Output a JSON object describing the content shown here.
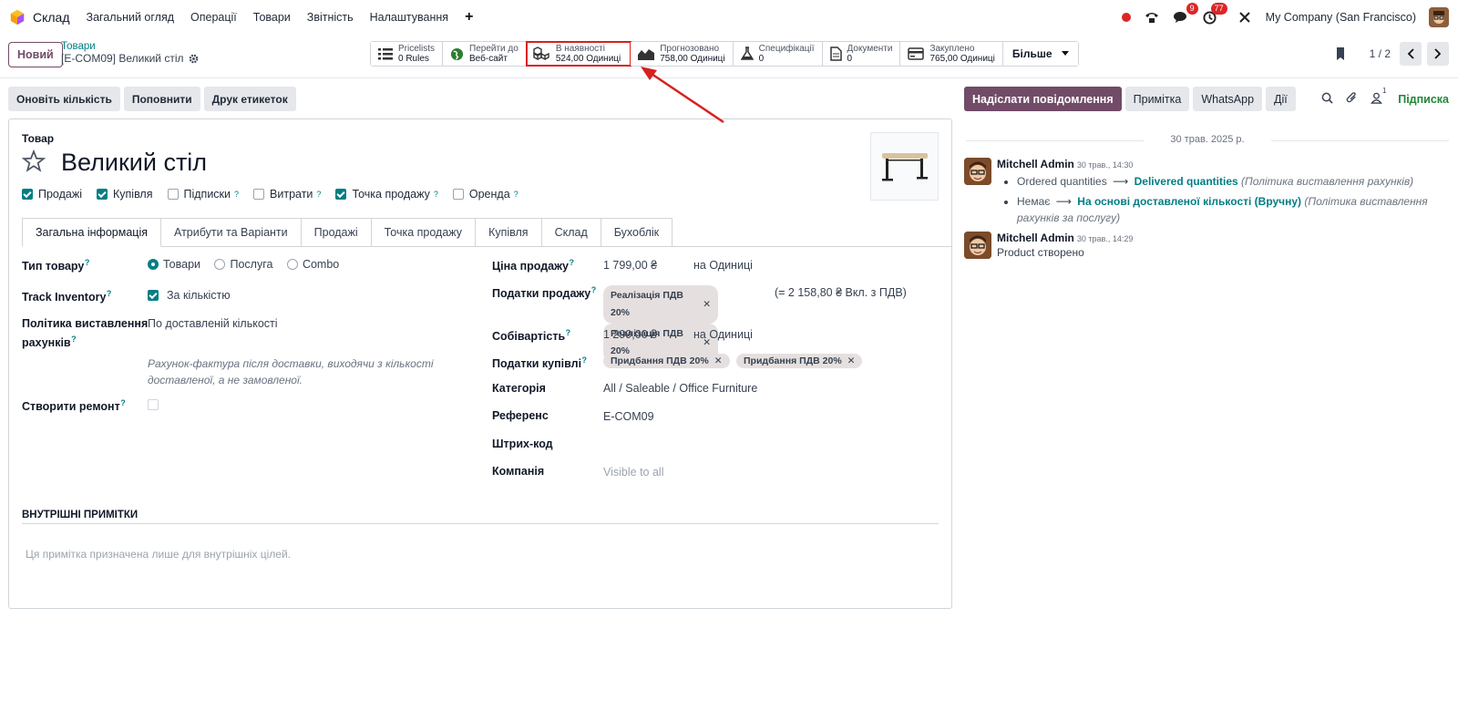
{
  "nav": {
    "app_name": "Склад",
    "menu": [
      "Загальний огляд",
      "Операції",
      "Товари",
      "Звітність",
      "Налаштування"
    ],
    "plus": "+",
    "messages_badge": "9",
    "activities_badge": "77",
    "company": "My Company (San Francisco)"
  },
  "control": {
    "new_button": "Новий",
    "breadcrumb_parent": "Товари",
    "breadcrumb_current": "[E-COM09] Великий стіл",
    "pager": "1 / 2",
    "more": "Більше"
  },
  "smart_buttons": [
    {
      "l1": "Pricelists",
      "l2": "0 Rules",
      "icon": "list-icon"
    },
    {
      "l1": "Перейти до",
      "l2": "Веб-сайт",
      "icon": "globe-icon"
    },
    {
      "l1": "В наявності",
      "l2": "524,00 Одиниці",
      "icon": "cubes-icon"
    },
    {
      "l1": "Прогнозовано",
      "l2": "758,00 Одиниці",
      "icon": "area-chart-icon"
    },
    {
      "l1": "Специфікації",
      "l2": "0",
      "icon": "flask-icon"
    },
    {
      "l1": "Документи",
      "l2": "0",
      "icon": "document-icon"
    },
    {
      "l1": "Закуплено",
      "l2": "765,00 Одиниці",
      "icon": "credit-card-icon"
    }
  ],
  "actions": [
    "Оновіть кількість",
    "Поповнити",
    "Друк етикеток"
  ],
  "product": {
    "type_label": "Товар",
    "name": "Великий стіл",
    "checkboxes": [
      {
        "label": "Продажі",
        "checked": true,
        "help": false
      },
      {
        "label": "Купівля",
        "checked": true,
        "help": false
      },
      {
        "label": "Підписки",
        "checked": false,
        "help": true
      },
      {
        "label": "Витрати",
        "checked": false,
        "help": true
      },
      {
        "label": "Точка продажу",
        "checked": true,
        "help": true
      },
      {
        "label": "Оренда",
        "checked": false,
        "help": true
      }
    ],
    "tabs": [
      "Загальна інформація",
      "Атрибути та Варіанти",
      "Продажі",
      "Точка продажу",
      "Купівля",
      "Склад",
      "Бухоблік"
    ]
  },
  "left_fields": {
    "product_type_label": "Тип товару",
    "product_type_options": [
      "Товари",
      "Послуга",
      "Combo"
    ],
    "track_label": "Track Inventory",
    "track_value": "За кількістю",
    "invoice_policy_label_1": "Політика виставлення",
    "invoice_policy_label_2": "рахунків",
    "invoice_policy_value": "По доставленій кількості",
    "invoice_hint_1": "Рахунок-фактура після доставки, виходячи з кількості",
    "invoice_hint_2": "доставленої, а не замовленої.",
    "repair_label": "Створити ремонт"
  },
  "right_fields": {
    "sale_price_label": "Ціна продажу",
    "sale_price": "1 799,00 ₴",
    "sale_uom": "на Одиниці",
    "sale_taxes_label": "Податки продажу",
    "sale_tax_tags": [
      "Реалізація ПДВ 20%",
      "Реалізація ПДВ 20%"
    ],
    "sale_taxes_incl": "(= 2 158,80 ₴ Вкл. з ПДВ)",
    "cost_label": "Собівартість",
    "cost": "1 299,00 ₴",
    "cost_uom": "на Одиниці",
    "purchase_taxes_label": "Податки купівлі",
    "purchase_tax_tags": [
      "Придбання ПДВ 20%",
      "Придбання ПДВ 20%"
    ],
    "category_label": "Категорія",
    "category": "All / Saleable / Office Furniture",
    "ref_label": "Референс",
    "ref": "E-COM09",
    "barcode_label": "Штрих-код",
    "company_label": "Компанія",
    "company_placeholder": "Visible to all"
  },
  "notes": {
    "heading": "ВНУТРІШНІ ПРИМІТКИ",
    "placeholder": "Ця примітка призначена лише для внутрішніх цілей."
  },
  "chatter": {
    "send_message": "Надіслати повідомлення",
    "log_note": "Примітка",
    "whatsapp": "WhatsApp",
    "activities": "Дії",
    "followers_count": "1",
    "follow": "Підписка",
    "date": "30 трав. 2025 р.",
    "messages": [
      {
        "author": "Mitchell Admin",
        "time": "30 трав., 14:30",
        "changes": [
          {
            "old": "Ordered quantities",
            "arrow": "⟶",
            "new": "Delivered quantities",
            "field": "(Політика виставлення рахунків)"
          },
          {
            "old": "Немає",
            "arrow": "⟶",
            "new": "На основі доставленої кількості (Вручну)",
            "field": "(Політика виставлення рахунків",
            "field2": "за послугу)"
          }
        ]
      },
      {
        "author": "Mitchell Admin",
        "time": "30 трав., 14:29",
        "body": "Product створено"
      }
    ]
  },
  "colors": {
    "brand": "#714b67",
    "accent": "#017e84",
    "highlight": "#d92020"
  }
}
